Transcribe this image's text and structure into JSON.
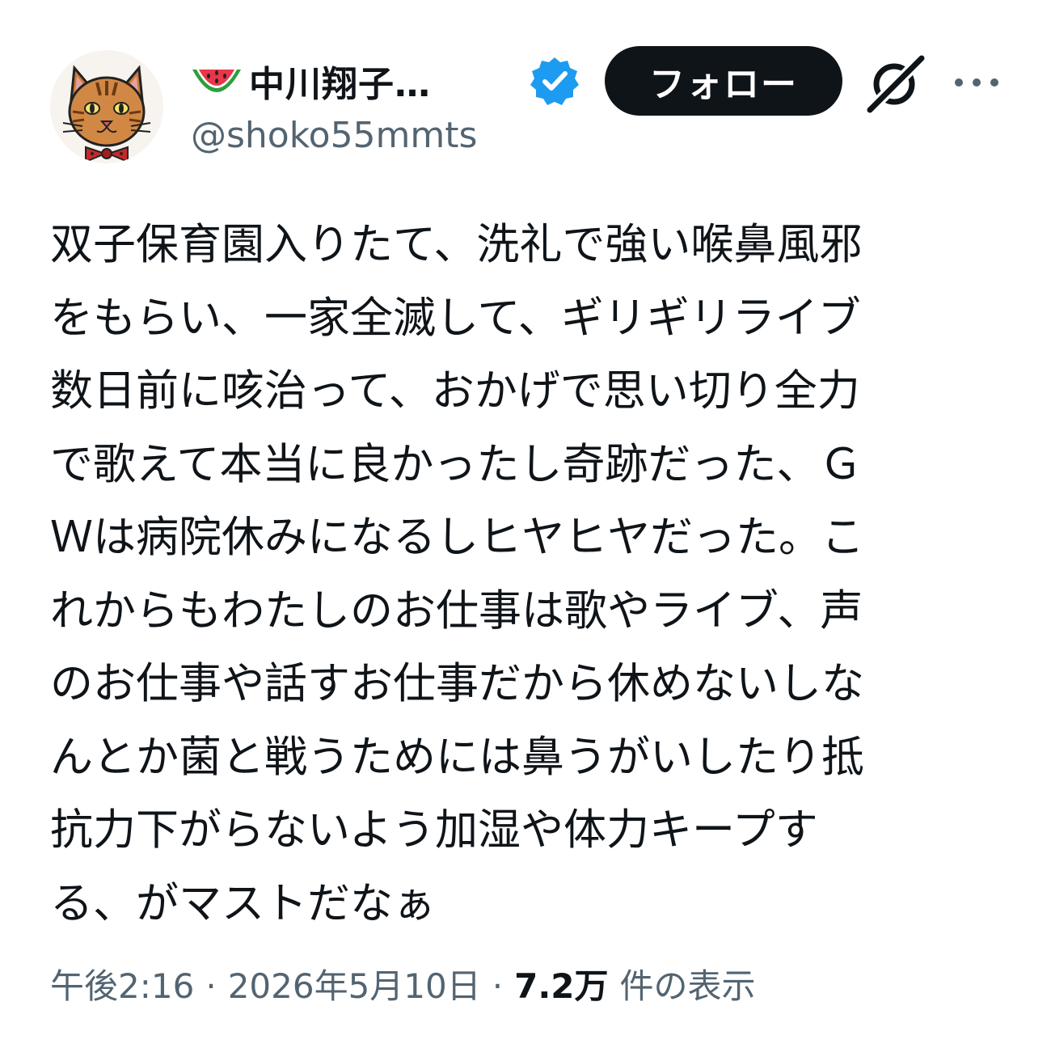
{
  "author": {
    "display_name": "中川翔子…",
    "handle": "@shoko55mmts",
    "verified": true,
    "name_emoji": "watermelon-icon"
  },
  "actions": {
    "follow_label": "フォロー",
    "grok_icon": "grok-icon",
    "more_icon": "more-icon"
  },
  "post": {
    "lines": [
      "双子保育園入りたて、洗礼で強い喉鼻風邪",
      "をもらい、一家全滅して、ギリギリライブ",
      "数日前に咳治って、おかげで思い切り全力",
      "で歌えて本当に良かったし奇跡だった、Ｇ",
      "Ｗは病院休みになるしヒヤヒヤだった。こ",
      "れからもわたしのお仕事は歌やライブ、声",
      "のお仕事や話すお仕事だから休めないしな",
      "んとか菌と戦うためには鼻うがいしたり抵",
      "抗力下がらないよう加湿や体力キープす",
      "る、がマストだなぁ"
    ]
  },
  "meta": {
    "time": "午後2:16",
    "separator": "·",
    "date": "2026年5月10日",
    "views_count": "7.2万",
    "views_label": "件の表示"
  },
  "colors": {
    "text": "#0f1419",
    "secondary": "#536471",
    "verified": "#1d9bf0",
    "button_bg": "#0f1419"
  }
}
